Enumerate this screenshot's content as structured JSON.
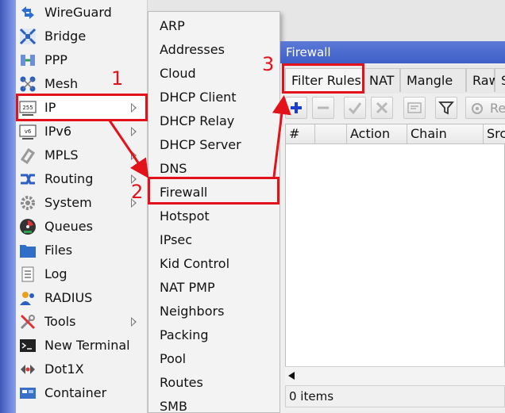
{
  "main_menu": {
    "items": [
      {
        "label": "WireGuard",
        "icon": "wireguard-icon",
        "submenu": false
      },
      {
        "label": "Bridge",
        "icon": "bridge-icon",
        "submenu": false
      },
      {
        "label": "PPP",
        "icon": "ppp-icon",
        "submenu": false
      },
      {
        "label": "Mesh",
        "icon": "mesh-icon",
        "submenu": false
      },
      {
        "label": "IP",
        "icon": "ip-icon",
        "submenu": true
      },
      {
        "label": "IPv6",
        "icon": "ipv6-icon",
        "submenu": true
      },
      {
        "label": "MPLS",
        "icon": "mpls-icon",
        "submenu": true
      },
      {
        "label": "Routing",
        "icon": "routing-icon",
        "submenu": true
      },
      {
        "label": "System",
        "icon": "system-icon",
        "submenu": true
      },
      {
        "label": "Queues",
        "icon": "queues-icon",
        "submenu": false
      },
      {
        "label": "Files",
        "icon": "files-icon",
        "submenu": false
      },
      {
        "label": "Log",
        "icon": "log-icon",
        "submenu": false
      },
      {
        "label": "RADIUS",
        "icon": "radius-icon",
        "submenu": false
      },
      {
        "label": "Tools",
        "icon": "tools-icon",
        "submenu": true
      },
      {
        "label": "New Terminal",
        "icon": "terminal-icon",
        "submenu": false
      },
      {
        "label": "Dot1X",
        "icon": "dot1x-icon",
        "submenu": false
      },
      {
        "label": "Container",
        "icon": "container-icon",
        "submenu": false
      }
    ]
  },
  "ip_submenu": {
    "items": [
      "ARP",
      "Addresses",
      "Cloud",
      "DHCP Client",
      "DHCP Relay",
      "DHCP Server",
      "DNS",
      "Firewall",
      "Hotspot",
      "IPsec",
      "Kid Control",
      "NAT PMP",
      "Neighbors",
      "Packing",
      "Pool",
      "Routes",
      "SMB"
    ]
  },
  "firewall_window": {
    "title": "Firewall",
    "tabs": [
      "Filter Rules",
      "NAT",
      "Mangle",
      "Raw",
      "S"
    ],
    "toolbar": {
      "add": "plus-icon",
      "remove": "minus-icon",
      "enable": "check-icon",
      "disable": "x-icon",
      "comment": "comment-icon",
      "filter": "filter-icon",
      "reset_label": "Re"
    },
    "columns": [
      "#",
      "",
      "Action",
      "Chain",
      "Src"
    ],
    "status": "0 items"
  },
  "annotations": {
    "step1": "1",
    "step2": "2",
    "step3": "3"
  },
  "colors": {
    "annotation": "#e3121a",
    "titlebar": "#4566cc",
    "accent_blue": "#1a3fd0"
  }
}
